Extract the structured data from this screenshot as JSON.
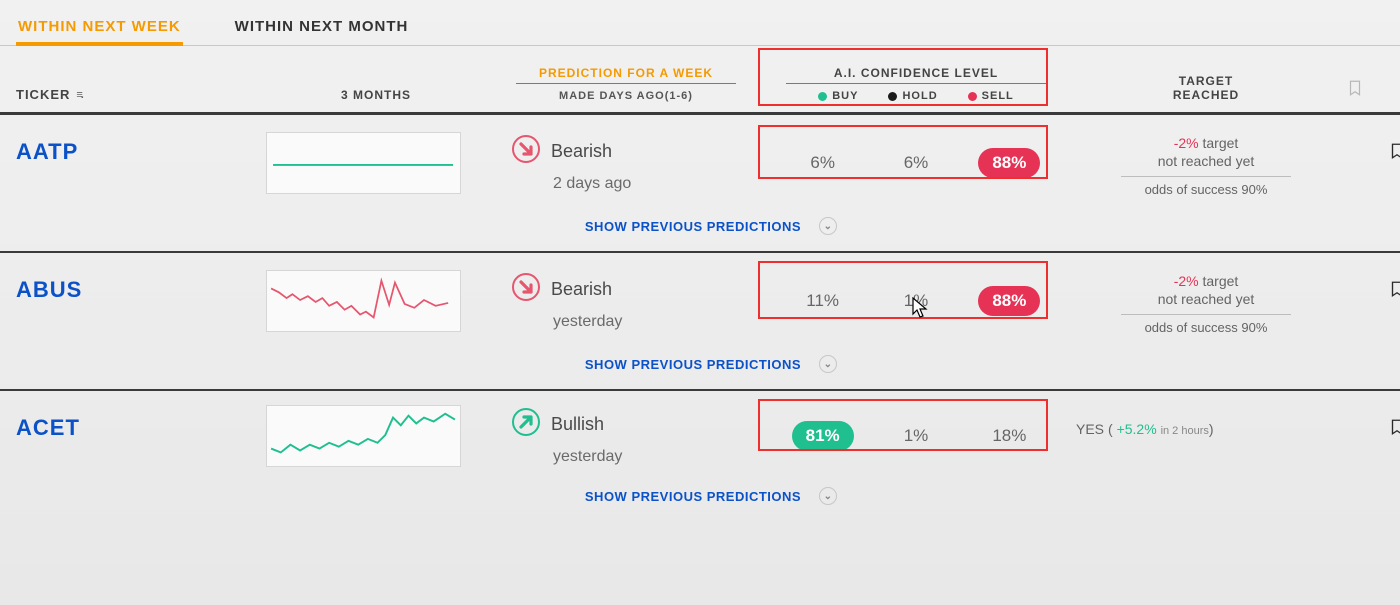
{
  "tabs": {
    "week": "WITHIN NEXT WEEK",
    "month": "WITHIN NEXT MONTH",
    "active": "week"
  },
  "columns": {
    "ticker": "TICKER",
    "months": "3 MONTHS",
    "predictionTop": "PREDICTION FOR A WEEK",
    "predictionSub": "MADE DAYS AGO(1-6)",
    "confidence": "A.I. CONFIDENCE LEVEL",
    "legend": {
      "buy": "BUY",
      "hold": "HOLD",
      "sell": "SELL"
    },
    "target": "TARGET\nREACHED"
  },
  "rows": [
    {
      "ticker": "AATP",
      "direction": "Bearish",
      "when": "2 days ago",
      "buy": "6%",
      "hold": "6%",
      "sell": "88%",
      "highlight": "sell",
      "target": {
        "mode": "pending",
        "pct": "-2%",
        "sign": "neg",
        "note": "target",
        "note2": "not reached yet",
        "odds": "odds of success 90%"
      },
      "showPrev": "SHOW PREVIOUS PREDICTIONS"
    },
    {
      "ticker": "ABUS",
      "direction": "Bearish",
      "when": "yesterday",
      "buy": "11%",
      "hold": "1%",
      "sell": "88%",
      "highlight": "sell",
      "target": {
        "mode": "pending",
        "pct": "-2%",
        "sign": "neg",
        "note": "target",
        "note2": "not reached yet",
        "odds": "odds of success 90%"
      },
      "showPrev": "SHOW PREVIOUS PREDICTIONS"
    },
    {
      "ticker": "ACET",
      "direction": "Bullish",
      "when": "yesterday",
      "buy": "81%",
      "hold": "1%",
      "sell": "18%",
      "highlight": "buy",
      "target": {
        "mode": "reached",
        "yes": "YES",
        "pct": "+5.2%",
        "sign": "pos",
        "trail": "in 2 hours"
      },
      "showPrev": "SHOW PREVIOUS PREDICTIONS"
    }
  ],
  "chart_data": [
    {
      "type": "line",
      "ticker": "AATP",
      "title": "3-month sparkline",
      "xlabel": "",
      "ylabel": "",
      "normalized_y": [
        0.5,
        0.5,
        0.5,
        0.5,
        0.5,
        0.5,
        0.5,
        0.5,
        0.5,
        0.5,
        0.5,
        0.5,
        0.5,
        0.5,
        0.5
      ],
      "color": "#1fbf8f"
    },
    {
      "type": "line",
      "ticker": "ABUS",
      "title": "3-month sparkline",
      "xlabel": "",
      "ylabel": "",
      "normalized_y": [
        0.6,
        0.58,
        0.48,
        0.55,
        0.45,
        0.5,
        0.42,
        0.47,
        0.35,
        0.4,
        0.3,
        0.34,
        0.24,
        0.88,
        0.55,
        0.85,
        0.55,
        0.48,
        0.58,
        0.5
      ],
      "color": "#e6566e"
    },
    {
      "type": "line",
      "ticker": "ACET",
      "title": "3-month sparkline",
      "xlabel": "",
      "ylabel": "",
      "normalized_y": [
        0.3,
        0.25,
        0.35,
        0.28,
        0.34,
        0.3,
        0.36,
        0.32,
        0.38,
        0.34,
        0.4,
        0.36,
        0.45,
        0.8,
        0.7,
        0.82,
        0.76,
        0.85,
        0.8,
        0.9
      ],
      "color": "#1fbf8f"
    }
  ],
  "colors": {
    "accent": "#f59a00",
    "link": "#0b52c8",
    "buy": "#1fbf8f",
    "sell": "#e63255"
  }
}
